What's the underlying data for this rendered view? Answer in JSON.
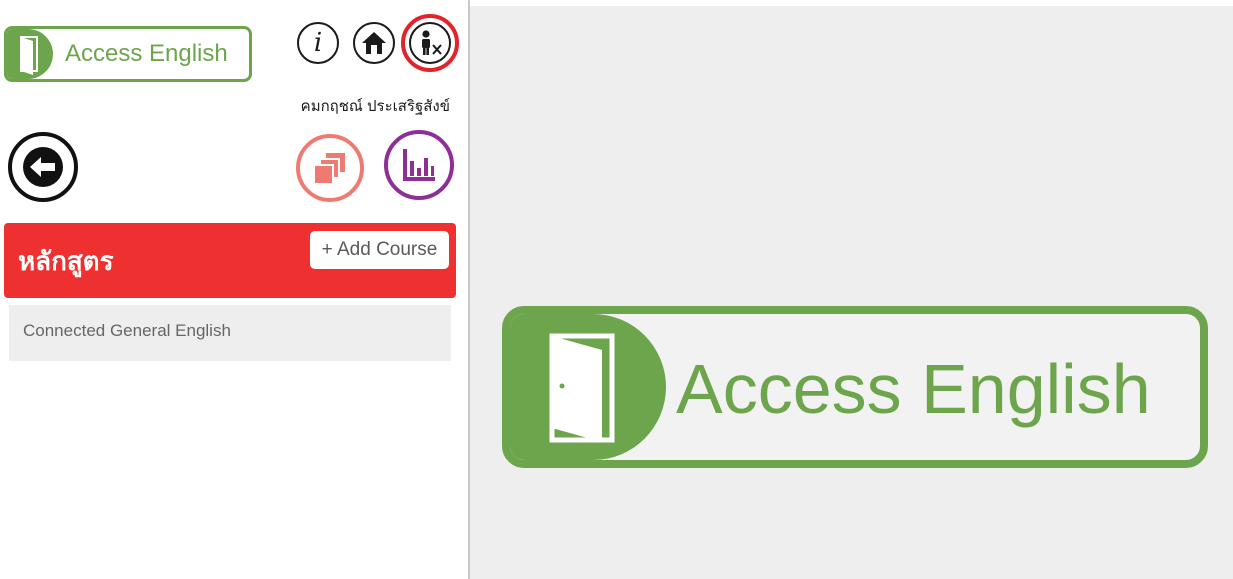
{
  "brand": {
    "name": "Access English",
    "color": "#6da54c"
  },
  "header": {
    "icons": [
      "info-icon",
      "home-icon",
      "user-remove-icon"
    ],
    "user_name": "คมกฤชณ์ ประเสริฐสังข์"
  },
  "toolbar": {
    "icons": [
      "back-arrow-icon",
      "cards-icon",
      "stats-icon"
    ]
  },
  "courses": {
    "title": "หลักสูตร",
    "add_label": "+ Add Course",
    "header_color": "#ee3130",
    "items": [
      {
        "label": "Connected General English"
      }
    ]
  },
  "annotation": {
    "color": "#e0242a"
  }
}
